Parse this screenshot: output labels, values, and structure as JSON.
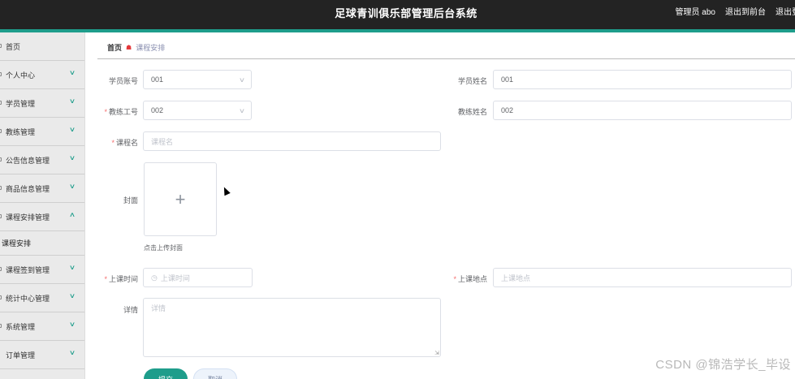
{
  "header": {
    "title": "足球青训俱乐部管理后台系统",
    "admin": "管理员 abo",
    "to_frontend": "退出到前台",
    "logout": "退出登"
  },
  "sidebar": {
    "items": [
      {
        "label": "首页"
      },
      {
        "label": "个人中心"
      },
      {
        "label": "学员管理"
      },
      {
        "label": "教练管理"
      },
      {
        "label": "公告信息管理"
      },
      {
        "label": "商品信息管理"
      },
      {
        "label": "课程安排管理"
      },
      {
        "label": "课程安排"
      },
      {
        "label": "课程签到管理"
      },
      {
        "label": "统计中心管理"
      },
      {
        "label": "系统管理"
      },
      {
        "label": "订单管理"
      }
    ]
  },
  "breadcrumb": {
    "home": "首页",
    "current": "课程安排"
  },
  "form": {
    "student_account": {
      "label": "学员账号",
      "value": "001"
    },
    "student_name": {
      "label": "学员姓名",
      "value": "001"
    },
    "coach_id": {
      "label": "教练工号",
      "value": "002"
    },
    "coach_name": {
      "label": "教练姓名",
      "value": "002"
    },
    "course_name": {
      "label": "课程名",
      "placeholder": "课程名"
    },
    "cover": {
      "label": "封面",
      "hint": "点击上传封面"
    },
    "class_time": {
      "label": "上课时间",
      "placeholder": "上课时间"
    },
    "class_location": {
      "label": "上课地点",
      "placeholder": "上课地点"
    },
    "details": {
      "label": "详情",
      "placeholder": "详情"
    },
    "submit_label": "提交",
    "cancel_label": "取消"
  },
  "watermark": "CSDN @锦浩学长_毕设",
  "colors": {
    "accent": "#1e9d8b",
    "topbar": "#232323",
    "sidebar": "#eaeaea",
    "required": "#f56c6c"
  }
}
